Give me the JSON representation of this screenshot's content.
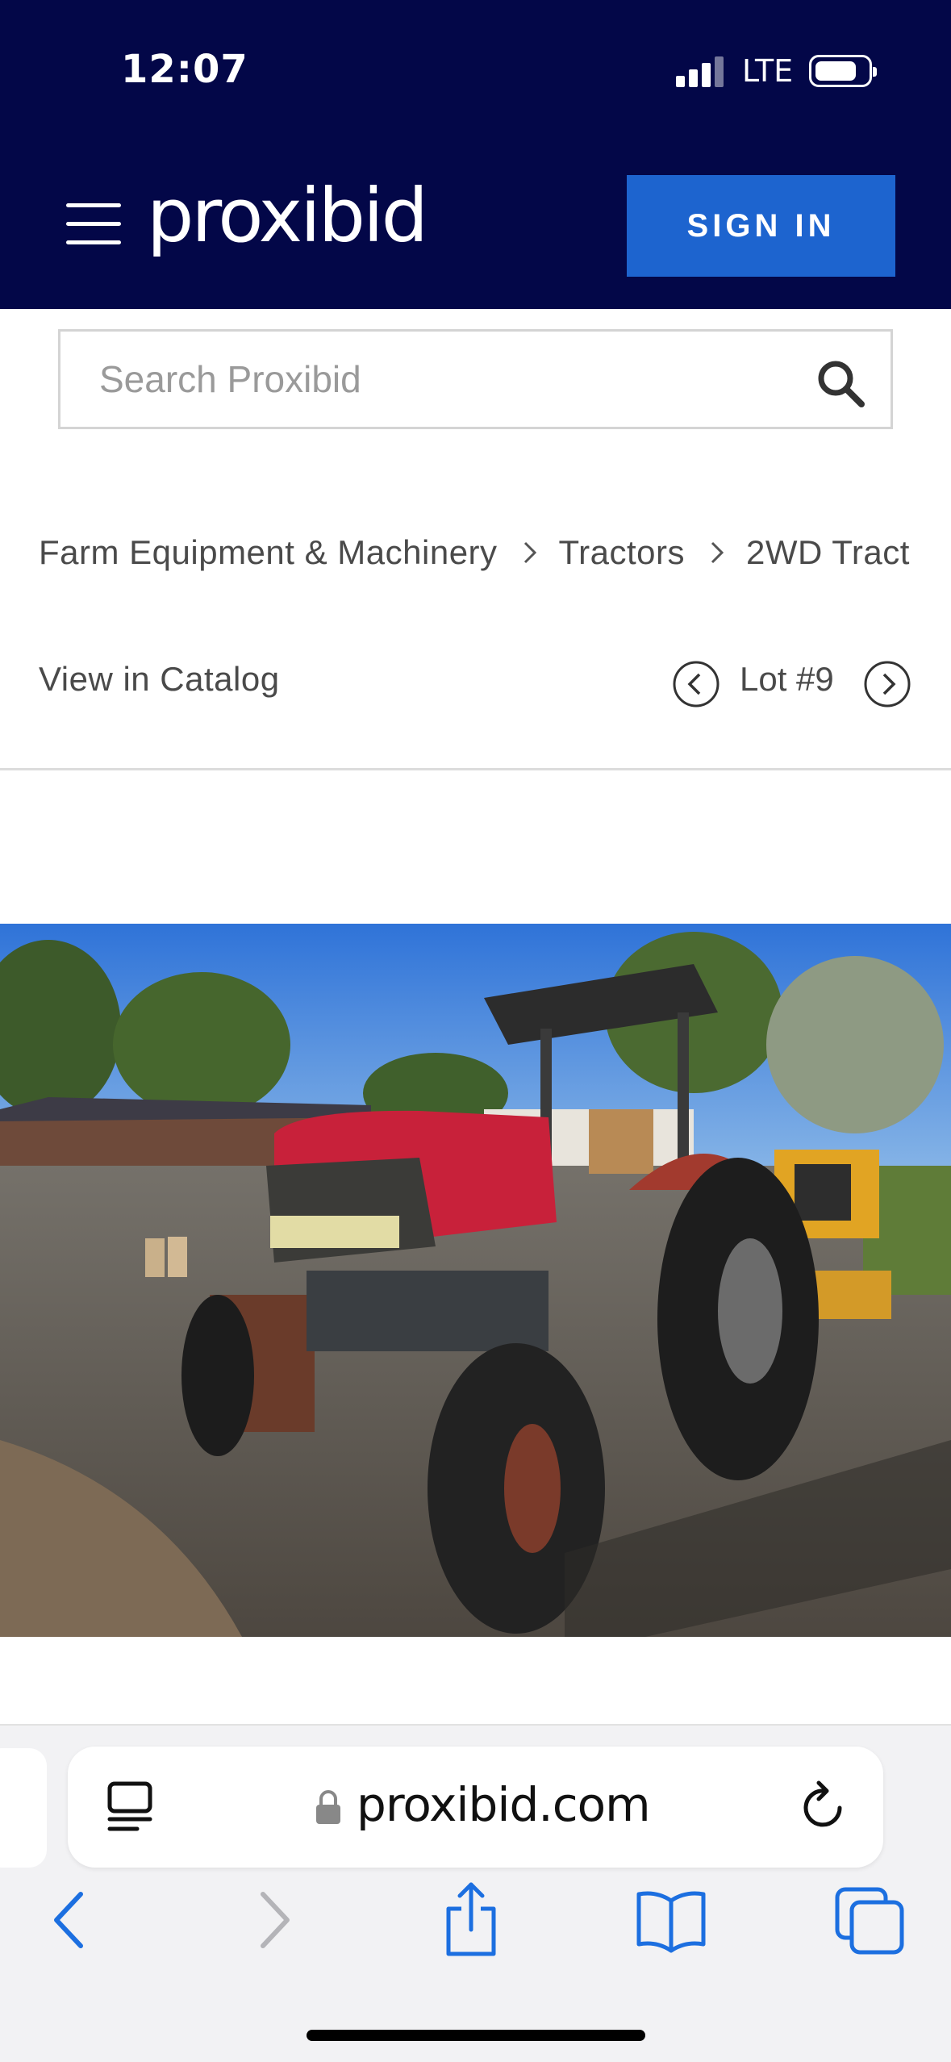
{
  "status_bar": {
    "time": "12:07",
    "network": "LTE"
  },
  "header": {
    "logo": "proxibid",
    "sign_in_label": "SIGN IN",
    "background_color": "#030748",
    "button_color": "#1d64cf"
  },
  "search": {
    "placeholder": "Search Proxibid"
  },
  "breadcrumb": {
    "items": [
      "Farm Equipment & Machinery",
      "Tractors",
      "2WD Tract"
    ]
  },
  "catalog": {
    "view_in_catalog_label": "View in Catalog",
    "lot_label": "Lot #9"
  },
  "browser": {
    "url": "proxibid.com"
  },
  "icons": [
    "menu-icon",
    "search-icon",
    "chevron-right-icon",
    "chevron-left-circle-icon",
    "chevron-right-circle-icon",
    "reader-icon",
    "lock-icon",
    "reload-icon",
    "back-icon",
    "forward-icon",
    "share-icon",
    "bookmarks-icon",
    "tabs-icon"
  ]
}
